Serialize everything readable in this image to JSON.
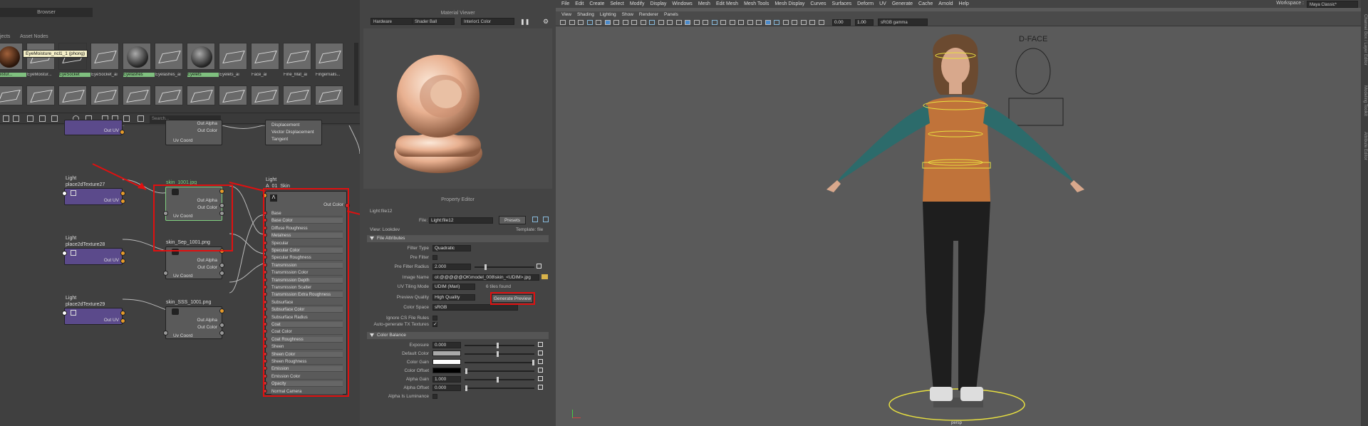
{
  "browser": {
    "title": "Browser",
    "tabs": [
      "jects",
      "Asset Nodes"
    ],
    "tooltip": "EyeMoisture_ncl1_1 (phong)",
    "swatches_row1": [
      {
        "label": "Moistur...",
        "kind": "sphere-brown",
        "highlight": true
      },
      {
        "label": "EyeMoistur...",
        "kind": "plane",
        "highlight": false
      },
      {
        "label": "EyeSocket",
        "kind": "plane-dark",
        "highlight": true
      },
      {
        "label": "EyeSocket_ai",
        "kind": "plane",
        "highlight": false
      },
      {
        "label": "Eyelashes",
        "kind": "sphere",
        "highlight": true
      },
      {
        "label": "Eyelashes_ai",
        "kind": "plane",
        "highlight": false
      },
      {
        "label": "Eyelets",
        "kind": "sphere",
        "highlight": true
      },
      {
        "label": "Eyelets_ai",
        "kind": "plane",
        "highlight": false
      },
      {
        "label": "Face_ai",
        "kind": "plane",
        "highlight": false
      },
      {
        "label": "Fine_Mat_ai",
        "kind": "plane",
        "highlight": false
      },
      {
        "label": "Fingernails...",
        "kind": "plane",
        "highlight": false
      }
    ],
    "search_placeholder": "Search..."
  },
  "graph": {
    "top_node": {
      "rows": [
        "Out UV",
        "Uv Coord"
      ],
      "right_rows": [
        "Out Alpha",
        "Out Color"
      ],
      "skin_rows": [
        "Displacement",
        "Vector Displacement",
        "Tangent"
      ]
    },
    "nodes": [
      {
        "group_title": "Light",
        "title": "place2dTexture27",
        "out": "Out UV"
      },
      {
        "group_title": "Light",
        "title": "place2dTexture28",
        "out": "Out UV"
      },
      {
        "group_title": "Light",
        "title": "place2dTexture29",
        "out": "Out UV"
      }
    ],
    "files": [
      {
        "title": "skin_1001.jpg",
        "rows": [
          "Out Alpha",
          "Out Color",
          "Uv Coord"
        ]
      },
      {
        "title": "skin_Sep_1001.png",
        "rows": [
          "Out Alpha",
          "Out Color",
          "Uv Coord"
        ]
      },
      {
        "title": "skin_SSS_1001.png",
        "rows": [
          "Out Alpha",
          "Out Color",
          "Uv Coord"
        ]
      }
    ],
    "shader": {
      "group_title": "Light",
      "title": "A_01_Skin",
      "out": "Out Color",
      "attrs": [
        "Base",
        "Base Color",
        "Diffuse Roughness",
        "Metalness",
        "Specular",
        "Specular Color",
        "Specular Roughness",
        "Transmission",
        "Transmission Color",
        "Transmission Depth",
        "Transmission Scatter",
        "Transmission Extra Roughness",
        "Subsurface",
        "Subsurface Color",
        "Subsurface Radius",
        "Coat",
        "Coat Color",
        "Coat Roughness",
        "Sheen",
        "Sheen Color",
        "Sheen Roughness",
        "Emission",
        "Emission Color",
        "Opacity",
        "Normal Camera"
      ]
    }
  },
  "material_viewer": {
    "title": "Material Viewer",
    "renderer": "Hardware",
    "shape": "Shader Ball",
    "environment": "Interior1 Color"
  },
  "property_editor": {
    "title": "Property Editor",
    "node_name": "Light:file12",
    "file_label": "File:",
    "file_value": "Light:file12",
    "presets": "Presets",
    "view_label": "View: Lookdev",
    "template_label": "Template: file",
    "section_file": "File Attributes",
    "rows": [
      {
        "label": "Filter Type",
        "value": "Quadratic"
      },
      {
        "label": "Pre Filter",
        "value": ""
      },
      {
        "label": "Pre Filter Radius",
        "value": "2.000"
      },
      {
        "label": "Image Name",
        "value": "ol:@@@@@OK\\model_008\\skin_<UDIM>.jpg"
      },
      {
        "label": "UV Tiling Mode",
        "value": "UDIM (Mari)",
        "extra": "6 tiles found"
      },
      {
        "label": "Preview Quality",
        "value": "High Quality"
      },
      {
        "label": "Color Space",
        "value": "sRGB"
      },
      {
        "label": "Ignore CS File Rules",
        "value": ""
      },
      {
        "label": "Auto-generate TX Textures",
        "value": "✓"
      }
    ],
    "generate_preview": "Generate Preview",
    "section_color": "Color Balance",
    "color_rows": [
      {
        "label": "Exposure",
        "value": "0.000"
      },
      {
        "label": "Default Color",
        "value": ""
      },
      {
        "label": "Color Gain",
        "value": ""
      },
      {
        "label": "Color Offset",
        "value": ""
      },
      {
        "label": "Alpha Gain",
        "value": "1.000"
      },
      {
        "label": "Alpha Offset",
        "value": "0.000"
      },
      {
        "label": "Alpha Is Luminance",
        "value": ""
      }
    ]
  },
  "main_menu": [
    "File",
    "Edit",
    "Create",
    "Select",
    "Modify",
    "Display",
    "Windows",
    "Mesh",
    "Edit Mesh",
    "Mesh Tools",
    "Mesh Display",
    "Curves",
    "Surfaces",
    "Deform",
    "UV",
    "Generate",
    "Cache",
    "Arnold",
    "Help"
  ],
  "workspace_label": "Workspace :",
  "workspace_value": "Maya Classic*",
  "viewport_menu": [
    "View",
    "Shading",
    "Lighting",
    "Show",
    "Renderer",
    "Panels"
  ],
  "viewport": {
    "field1": "0.00",
    "field2": "1.00",
    "color_space": "sRGB gamma",
    "camera_label": "persp",
    "face_label": "D-FACE"
  },
  "side_tabs": [
    "Channel Box / Layer Editor",
    "Modeling Toolkit",
    "Attribute Editor"
  ],
  "colors": {
    "annotation": "#e01010",
    "accent_orange": "#e79b2a",
    "node_purple": "#5b4a8b"
  }
}
